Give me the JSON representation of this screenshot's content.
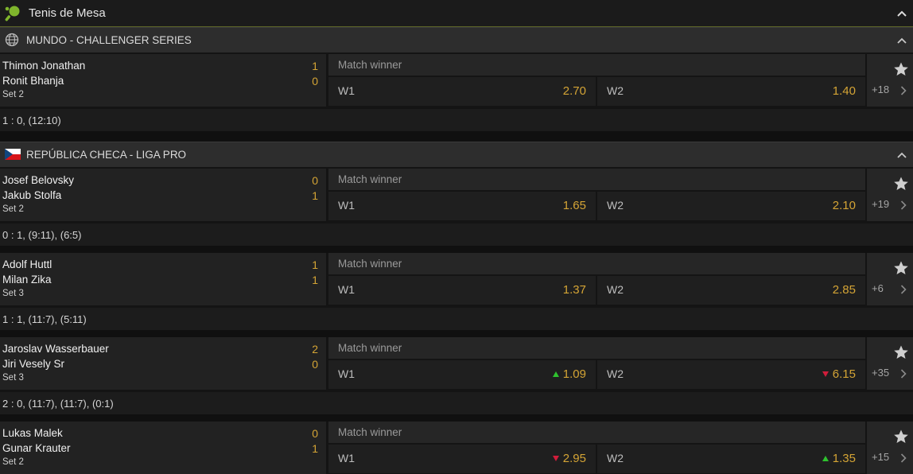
{
  "header": {
    "title": "Tenis de Mesa",
    "icon": "table-tennis-icon"
  },
  "leagues": [
    {
      "name": "MUNDO - CHALLENGER SERIES",
      "icon": "globe-icon",
      "matches": [
        {
          "team1": "Thimon Jonathan",
          "team2": "Ronit Bhanja",
          "score1": "1",
          "score2": "0",
          "set": "Set 2",
          "market": "Match winner",
          "w1_label": "W1",
          "w1": "2.70",
          "w1_trend": "",
          "w2_label": "W2",
          "w2": "1.40",
          "w2_trend": "",
          "more": "+18",
          "status": "1 : 0, (12:10)"
        }
      ]
    },
    {
      "name": "REPÚBLICA CHECA - LIGA PRO",
      "icon": "czech-flag-icon",
      "matches": [
        {
          "team1": "Josef Belovsky",
          "team2": "Jakub Stolfa",
          "score1": "0",
          "score2": "1",
          "set": "Set 2",
          "market": "Match winner",
          "w1_label": "W1",
          "w1": "1.65",
          "w1_trend": "",
          "w2_label": "W2",
          "w2": "2.10",
          "w2_trend": "",
          "more": "+19",
          "status": "0 : 1, (9:11), (6:5)"
        },
        {
          "team1": "Adolf Huttl",
          "team2": "Milan Zika",
          "score1": "1",
          "score2": "1",
          "set": "Set 3",
          "market": "Match winner",
          "w1_label": "W1",
          "w1": "1.37",
          "w1_trend": "",
          "w2_label": "W2",
          "w2": "2.85",
          "w2_trend": "",
          "more": "+6",
          "status": "1 : 1, (11:7), (5:11)"
        },
        {
          "team1": "Jaroslav Wasserbauer",
          "team2": "Jiri Vesely Sr",
          "score1": "2",
          "score2": "0",
          "set": "Set 3",
          "market": "Match winner",
          "w1_label": "W1",
          "w1": "1.09",
          "w1_trend": "up",
          "w2_label": "W2",
          "w2": "6.15",
          "w2_trend": "down",
          "more": "+35",
          "status": "2 : 0, (11:7), (11:7), (0:1)"
        },
        {
          "team1": "Lukas Malek",
          "team2": "Gunar Krauter",
          "score1": "0",
          "score2": "1",
          "set": "Set 2",
          "market": "Match winner",
          "w1_label": "W1",
          "w1": "2.95",
          "w1_trend": "down",
          "w2_label": "W2",
          "w2": "1.35",
          "w2_trend": "up",
          "more": "+15",
          "status": ""
        }
      ]
    }
  ],
  "colors": {
    "odd": "#d4a435",
    "up": "#2ec22e",
    "down": "#d11d3b",
    "accent_line": "#5c6327"
  }
}
